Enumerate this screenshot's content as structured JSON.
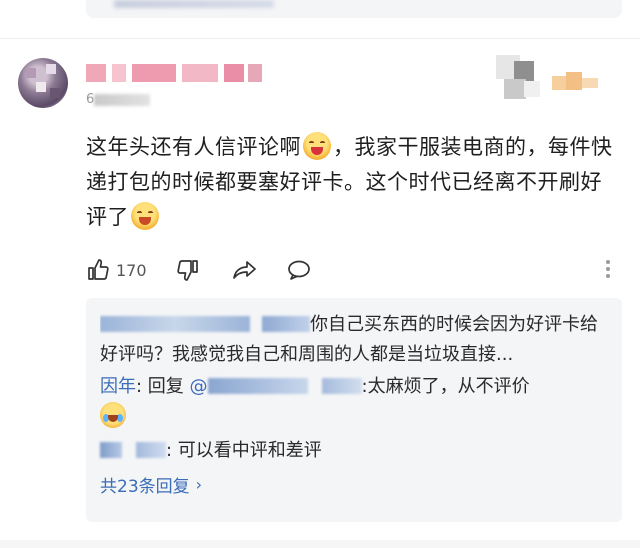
{
  "comment": {
    "timestamp_prefix": "6",
    "text_part1": "这年头还有人信评论啊",
    "text_part2": "，我家干服装电商的，每件快递打包的时候都要塞好评卡。这个时代已经离不开刷好评了",
    "emoji1": "grinning-face-emoji",
    "emoji2": "laughing-face-emoji"
  },
  "actions": {
    "like_count": "170",
    "like_icon": "thumbs-up-icon",
    "dislike_icon": "thumbs-down-icon",
    "share_icon": "share-icon",
    "reply_icon": "comment-bubble-icon",
    "more_icon": "more-vertical-icon"
  },
  "replies": {
    "items": [
      {
        "text": "你自己买东西的时候会因为好评卡给好评吗？我感觉我自己和周围的人都是当垃圾直接..."
      },
      {
        "name": "因年",
        "prefix": ": 回复 ",
        "mention_prefix": "@",
        "text": ":太麻烦了，从不评价",
        "emoji": "crying-laughing-emoji"
      },
      {
        "text": ": 可以看中评和差评"
      }
    ],
    "more_label": "共23条回复",
    "more_chevron": "›"
  },
  "colors": {
    "link_blue": "#3b6cb7",
    "reply_bg": "#f4f5f7",
    "text_dark": "#1f1f1f",
    "muted": "#999999"
  }
}
